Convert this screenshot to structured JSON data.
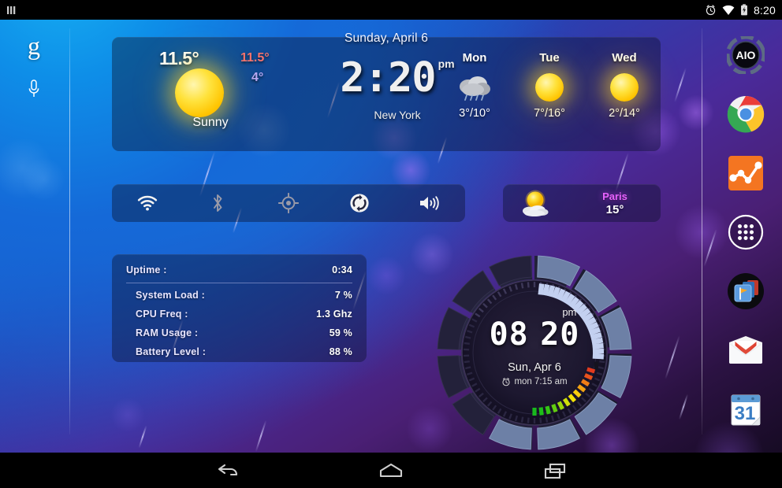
{
  "statusbar": {
    "time": "8:20",
    "icons": [
      "menu-bars-icon",
      "alarm-icon",
      "wifi-icon",
      "battery-charging-icon"
    ]
  },
  "navbar": {
    "back_label": "Back",
    "home_label": "Home",
    "recents_label": "Recent apps"
  },
  "search": {
    "logo": "g",
    "mic_icon": "microphone-icon"
  },
  "weather": {
    "date": "Sunday, April 6",
    "current": {
      "temp": "11.5°",
      "high": "11.5°",
      "low": "4°",
      "condition": "Sunny",
      "icon": "sun-icon"
    },
    "clock": {
      "time": "2:20",
      "ampm": "pm",
      "city": "New York"
    },
    "forecast": [
      {
        "day": "Mon",
        "icon": "rain-cloud-icon",
        "temps": "3°/10°"
      },
      {
        "day": "Tue",
        "icon": "sun-icon",
        "temps": "7°/16°"
      },
      {
        "day": "Wed",
        "icon": "sun-icon",
        "temps": "2°/14°"
      }
    ]
  },
  "toggles": [
    {
      "name": "wifi-toggle",
      "icon": "wifi-icon",
      "state": "on"
    },
    {
      "name": "bluetooth-toggle",
      "icon": "bluetooth-icon",
      "state": "off"
    },
    {
      "name": "gps-toggle",
      "icon": "gps-crosshair-icon",
      "state": "off"
    },
    {
      "name": "sync-toggle",
      "icon": "sync-icon",
      "state": "on"
    },
    {
      "name": "volume-toggle",
      "icon": "speaker-icon",
      "state": "on"
    }
  ],
  "paris_weather": {
    "city": "Paris",
    "temp": "15°",
    "icon": "sun-behind-cloud-icon"
  },
  "system_info": {
    "uptime_label": "Uptime :",
    "uptime_value": "0:34",
    "rows": [
      {
        "label": "System Load :",
        "value": "7 %"
      },
      {
        "label": "CPU Freq :",
        "value": "1.3 Ghz"
      },
      {
        "label": "RAM Usage :",
        "value": "59 %"
      },
      {
        "label": "Battery Level :",
        "value": "88 %"
      }
    ]
  },
  "clock_widget": {
    "hours": "08",
    "minutes": "20",
    "ampm": "pm",
    "date": "Sun, Apr 6",
    "alarm": "mon 7:15 am",
    "alarm_icon": "alarm-clock-icon"
  },
  "dock": [
    {
      "name": "aio-launcher-icon",
      "label": "AIO"
    },
    {
      "name": "chrome-icon",
      "label": "Chrome"
    },
    {
      "name": "analytics-icon",
      "label": "Analytics"
    },
    {
      "name": "app-drawer-icon",
      "label": "Apps"
    },
    {
      "name": "folder-flag-icon",
      "label": "Folder"
    },
    {
      "name": "gmail-icon",
      "label": "Gmail"
    },
    {
      "name": "calendar-icon",
      "label": "Calendar",
      "day": "31"
    }
  ],
  "colors": {
    "accent_blue": "#16aff2",
    "accent_purple": "#4a2a9a",
    "temp_high": "#f5736e",
    "temp_low": "#b9a8f5",
    "paris_pink": "#e663ff",
    "panel_bg": "rgba(10,16,40,0.40)"
  }
}
